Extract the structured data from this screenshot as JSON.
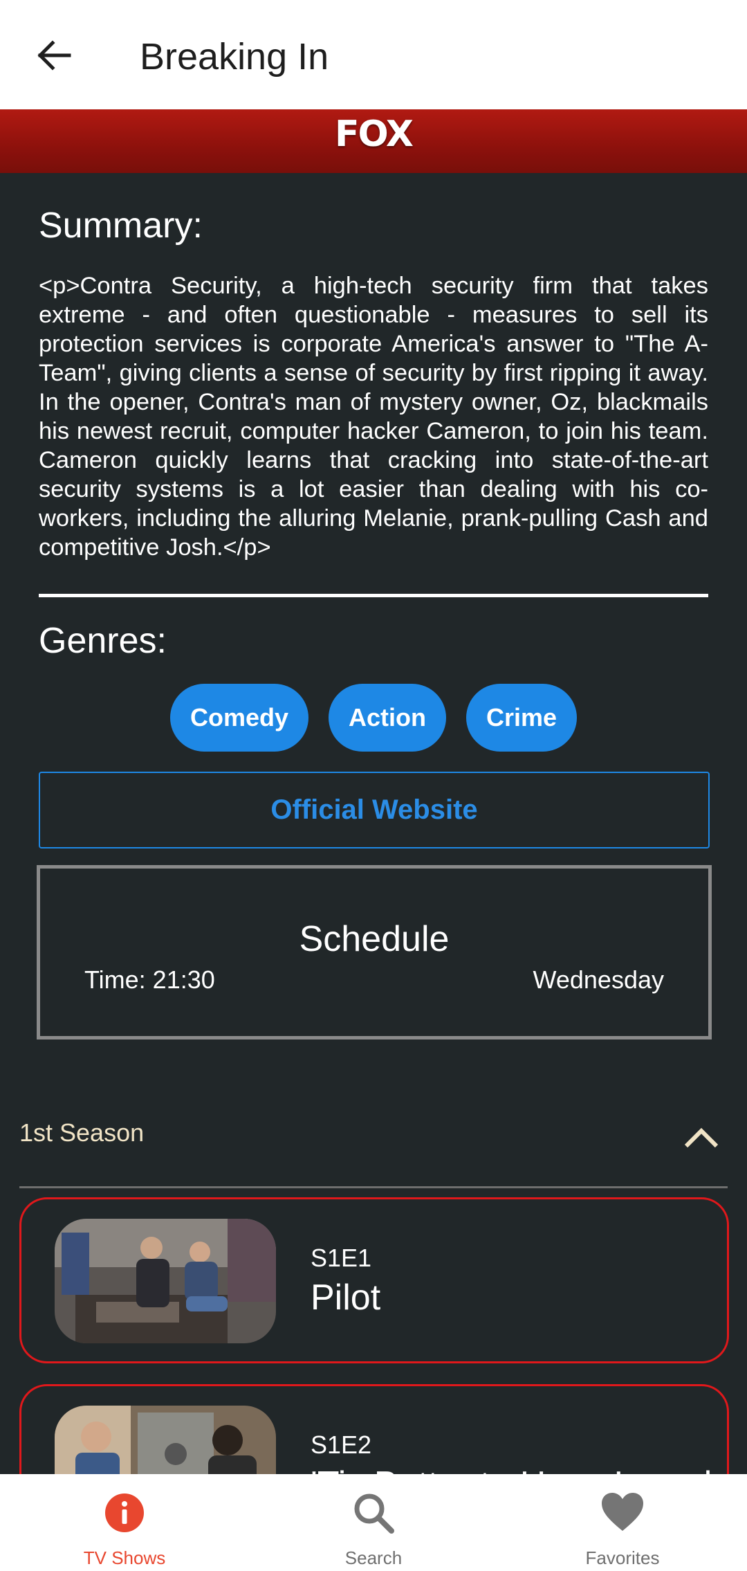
{
  "app_bar": {
    "title": "Breaking In"
  },
  "network": {
    "logo_text": "FOX"
  },
  "summary": {
    "heading": "Summary:",
    "text": "<p>Contra Security, a high-tech security firm that takes extreme - and often questionable - measures to sell its protection services is corporate America's answer to \"The A-Team\", giving clients a sense of security by first ripping it away. In the opener, Contra's man of mystery owner, Oz, blackmails his newest recruit, computer hacker Cameron, to join his team. Cameron quickly learns that cracking into state-of-the-art security systems is a lot easier than dealing with his co-workers, including the alluring Melanie, prank-pulling Cash and competitive Josh.</p>"
  },
  "genres": {
    "heading": "Genres:",
    "items": [
      "Comedy",
      "Action",
      "Crime"
    ]
  },
  "website_button": {
    "label": "Official Website"
  },
  "schedule": {
    "title": "Schedule",
    "time": "Time: 21:30",
    "day": "Wednesday"
  },
  "season": {
    "label": "1st Season",
    "expanded": true
  },
  "episodes": [
    {
      "code": "S1E1",
      "title": "Pilot"
    },
    {
      "code": "S1E2",
      "title": "'Tis Better to Have Loved"
    }
  ],
  "bottom_nav": {
    "items": [
      {
        "label": "TV Shows",
        "icon": "info-icon",
        "active": true
      },
      {
        "label": "Search",
        "icon": "search-icon",
        "active": false
      },
      {
        "label": "Favorites",
        "icon": "heart-icon",
        "active": false
      }
    ]
  },
  "colors": {
    "accent_blue": "#1e88e5",
    "episode_border": "#e0181b",
    "active_nav": "#e8472f",
    "background": "#212729"
  }
}
